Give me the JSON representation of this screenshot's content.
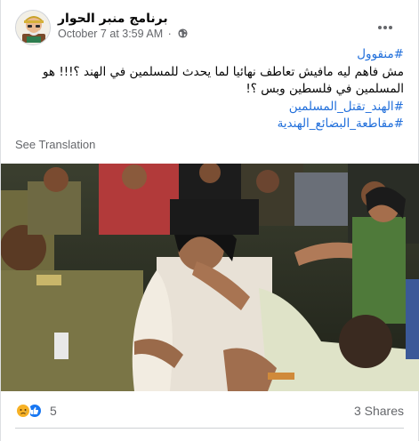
{
  "post": {
    "author": "برنامج منبر الحوار",
    "timestamp": "October 7 at 3:59 AM",
    "separator": "·",
    "privacy_icon": "globe-icon",
    "menu_icon": "more-horizontal-icon",
    "body": {
      "hashtag_top": "#منقوول",
      "line1": "مش فاهم ليه مافيش تعاطف نهائيا لما يحدث للمسلمين في الهند ؟!!! هو",
      "line2": "المسلمين في فلسطين وبس ؟!",
      "hashtag_1": "#الهند_تقتل_المسلمين",
      "hashtag_2": "#مقاطعة_البضائع_الهندية"
    },
    "see_translation": "See Translation",
    "photo_icon": "post-photo",
    "reactions": {
      "icons": [
        "sad-reaction-icon",
        "like-reaction-icon"
      ],
      "count": "5"
    },
    "shares": "3 Shares"
  },
  "colors": {
    "link_blue": "#216fdb",
    "meta_gray": "#65676b",
    "like_blue": "#1877f2",
    "sad_yellow": "#f7b125"
  }
}
